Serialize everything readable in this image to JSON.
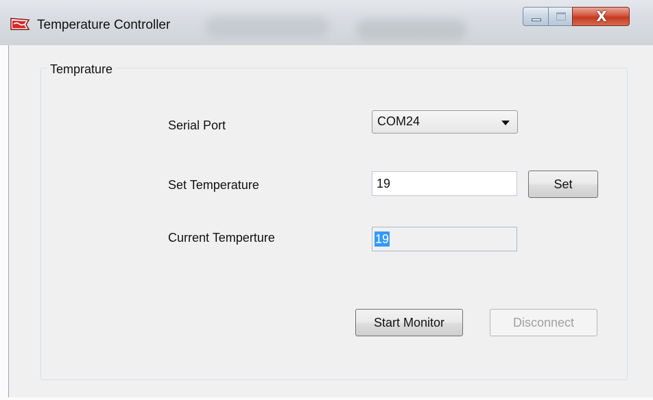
{
  "window": {
    "title": "Temperature Controller",
    "caption": {
      "minimize_icon": "minimize-icon",
      "maximize_icon": "maximize-icon",
      "close_glyph": "X"
    }
  },
  "group": {
    "title": "Temprature"
  },
  "serial_port": {
    "label": "Serial Port",
    "selected": "COM24"
  },
  "set_temperature": {
    "label": "Set Temperature",
    "value": "19",
    "button_label": "Set"
  },
  "current_temperature": {
    "label": "Current Temperture",
    "value": "19"
  },
  "actions": {
    "start_label": "Start Monitor",
    "disconnect_label": "Disconnect"
  },
  "colors": {
    "selection": "#3399ff",
    "close_button": "#c23b22",
    "client_bg": "#f0f0f0"
  }
}
